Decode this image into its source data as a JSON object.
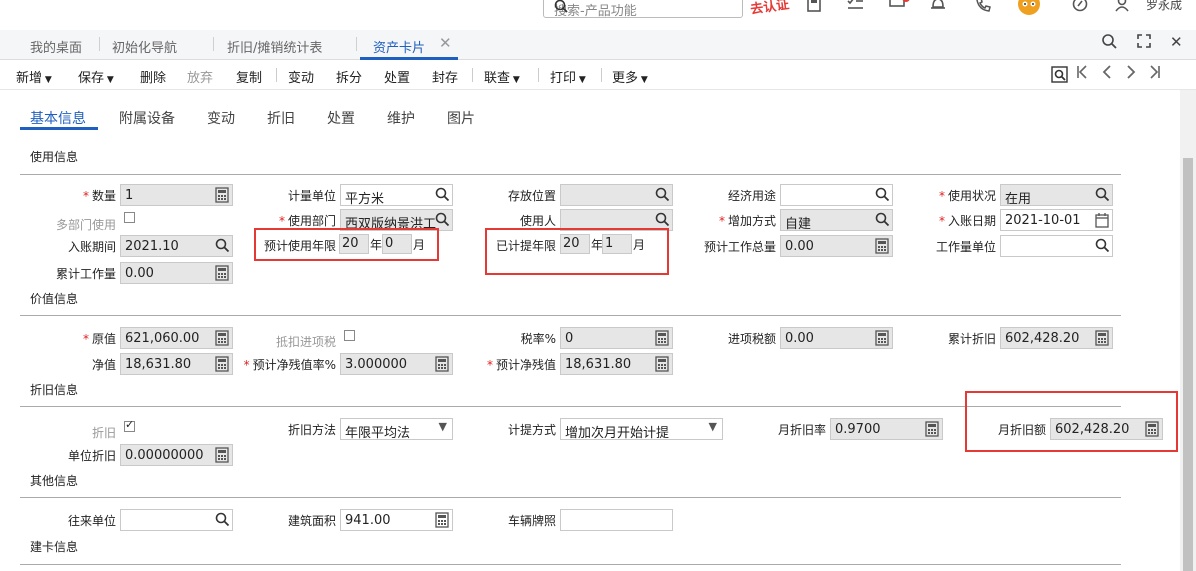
{
  "header": {
    "search_placeholder": "搜索-产品功能",
    "auth_badge": "去认证",
    "user_name": "罗永成"
  },
  "tabs": [
    {
      "label": "我的桌面"
    },
    {
      "label": "初始化导航"
    },
    {
      "label": "折旧/摊销统计表"
    },
    {
      "label": "资产卡片"
    }
  ],
  "toolbar": {
    "new": "新增",
    "save": "保存",
    "delete": "删除",
    "discard": "放弃",
    "copy": "复制",
    "change": "变动",
    "split": "拆分",
    "dispose": "处置",
    "seal": "封存",
    "link": "联查",
    "print": "打印",
    "more": "更多"
  },
  "subtabs": [
    "基本信息",
    "附属设备",
    "变动",
    "折旧",
    "处置",
    "维护",
    "图片"
  ],
  "sections": {
    "usage": "使用信息",
    "value": "价值信息",
    "depreciation": "折旧信息",
    "other": "其他信息",
    "card": "建卡信息"
  },
  "usage": {
    "qty_label": "数量",
    "qty_value": "1",
    "unit_label": "计量单位",
    "unit_value": "平方米",
    "location_label": "存放位置",
    "location_value": "",
    "econ_label": "经济用途",
    "econ_value": "",
    "status_label": "使用状况",
    "status_value": "在用",
    "multi_dept_label": "多部门使用",
    "dept_label": "使用部门",
    "dept_value": "西双版纳景洪工",
    "user_label": "使用人",
    "user_value": "",
    "add_method_label": "增加方式",
    "add_method_value": "自建",
    "entry_date_label": "入账日期",
    "entry_date_value": "2021-10-01",
    "entry_period_label": "入账期间",
    "entry_period_value": "2021.10",
    "est_life_label": "预计使用年限",
    "est_life_years": "20",
    "est_life_months": "0",
    "used_label": "已计提年限",
    "used_years": "20",
    "used_months": "1",
    "year_unit": "年",
    "month_unit": "月",
    "est_work_label": "预计工作总量",
    "est_work_value": "0.00",
    "work_unit_label": "工作量单位",
    "work_unit_value": "",
    "acc_work_label": "累计工作量",
    "acc_work_value": "0.00"
  },
  "value": {
    "orig_label": "原值",
    "orig_value": "621,060.00",
    "deduct_label": "抵扣进项税",
    "tax_rate_label": "税率%",
    "tax_rate_value": "0",
    "input_tax_label": "进项税额",
    "input_tax_value": "0.00",
    "acc_dep_label": "累计折旧",
    "acc_dep_value": "602,428.20",
    "net_label": "净值",
    "net_value": "18,631.80",
    "residual_rate_label": "预计净残值率%",
    "residual_rate_value": "3.000000",
    "residual_label": "预计净残值",
    "residual_value": "18,631.80"
  },
  "depreciation": {
    "dep_label": "折旧",
    "method_label": "折旧方法",
    "method_value": "年限平均法",
    "calc_label": "计提方式",
    "calc_value": "增加次月开始计提",
    "monthly_rate_label": "月折旧率",
    "monthly_rate_value": "0.9700",
    "monthly_amt_label": "月折旧额",
    "monthly_amt_value": "602,428.20",
    "unit_dep_label": "单位折旧",
    "unit_dep_value": "0.00000000"
  },
  "other": {
    "partner_label": "往来单位",
    "partner_value": "",
    "area_label": "建筑面积",
    "area_value": "941.00",
    "plate_label": "车辆牌照",
    "plate_value": ""
  },
  "colors": {
    "accent": "#1f5fbf",
    "required": "#e02020",
    "highlight_box": "#e53935"
  }
}
